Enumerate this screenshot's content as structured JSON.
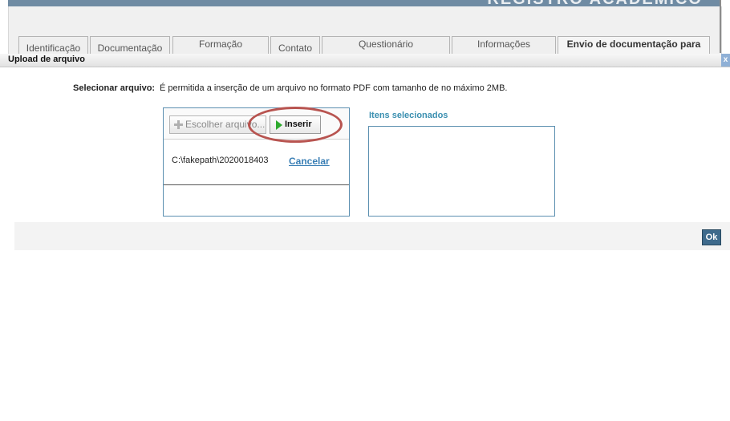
{
  "header": {
    "title": "REGISTRO ACADÊMICO"
  },
  "tabs": [
    {
      "label": "Identificação"
    },
    {
      "label": "Documentação"
    },
    {
      "label": "Formação"
    },
    {
      "label": "Contato"
    },
    {
      "label": "Questionário"
    },
    {
      "label": "Informações"
    },
    {
      "label": "Envio de documentação para"
    }
  ],
  "dialog": {
    "title": "Upload de arquivo",
    "close_glyph": "x",
    "select_label": "Selecionar arquivo:",
    "select_info": "É permitida a inserção de um arquivo no formato PDF com tamanho de no máximo 2MB.",
    "choose_button": "Escolher arquivo...",
    "insert_button": "Inserir",
    "file_path": "C:\\fakepath\\2020018403",
    "cancel_link": "Cancelar",
    "selected_items_label": "Itens selecionados",
    "ok_button": "Ok"
  },
  "colors": {
    "accent": "#3a8fb0",
    "highlight": "#b85450",
    "ok_button_bg": "#3e6a8c"
  }
}
